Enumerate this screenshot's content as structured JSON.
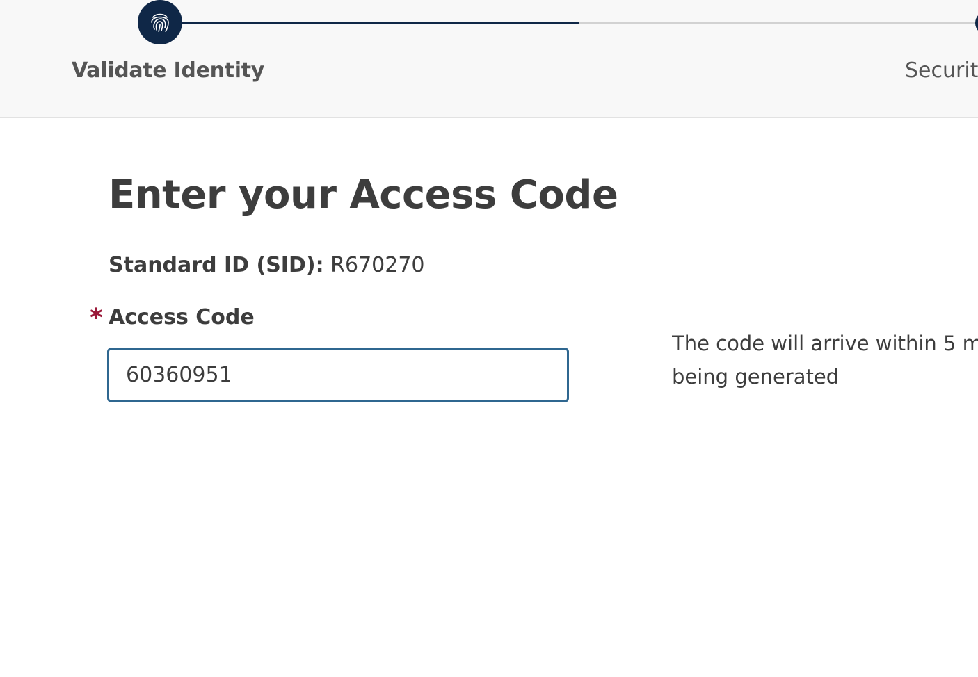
{
  "stepper": {
    "steps": [
      {
        "label": "Validate Identity",
        "icon": "fingerprint-icon",
        "state": "active"
      },
      {
        "label": "Security",
        "state": "upcoming"
      }
    ],
    "accent_color": "#0f2747"
  },
  "main": {
    "title": "Enter your Access Code",
    "sid_label": "Standard ID (SID):",
    "sid_value": "R670270",
    "access_code": {
      "required_marker": "*",
      "label": "Access Code",
      "value": "60360951"
    },
    "hint_line_1": "The code will arrive within 5 m",
    "hint_line_2": "being generated"
  }
}
